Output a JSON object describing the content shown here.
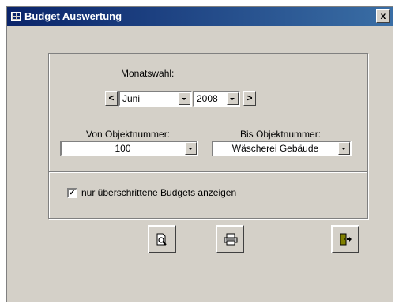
{
  "window": {
    "title": "Budget Auswertung",
    "close_label": "x"
  },
  "month_selection": {
    "label": "Monatswahl:",
    "prev_label": "<",
    "next_label": ">",
    "month": "Juni",
    "year": "2008"
  },
  "object_range": {
    "from_label": "Von Objektnummer:",
    "from_value": "100",
    "to_label": "Bis Objektnummer:",
    "to_value": "Wäscherei Gebäude"
  },
  "filter": {
    "checkbox_label": "nur überschrittene Budgets anzeigen",
    "checked": true,
    "check_mark": "✓"
  },
  "toolbar": {
    "preview_icon": "print-preview-icon",
    "print_icon": "printer-icon",
    "exit_icon": "exit-door-icon"
  }
}
